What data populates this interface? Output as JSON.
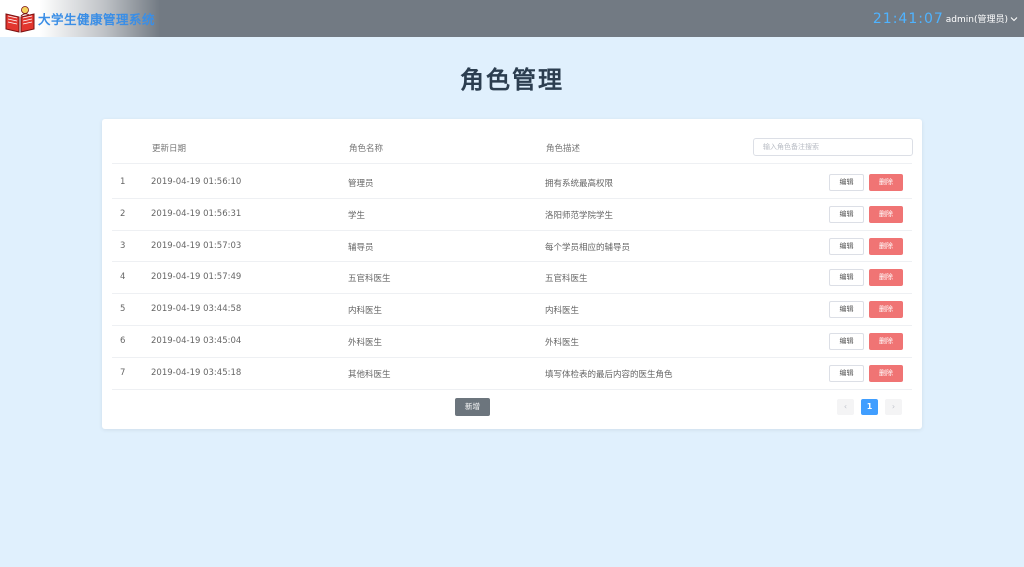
{
  "header": {
    "title": "大学生健康管理系统",
    "clock": "21:41:07",
    "user": "admin(管理员)",
    "colors": {
      "bar": "#727a83",
      "title": "#3a8ee6",
      "clock": "#4fb3ff"
    }
  },
  "page": {
    "title": "角色管理"
  },
  "table": {
    "columns": [
      "更新日期",
      "角色名称",
      "角色描述"
    ],
    "search_placeholder": "输入角色备注搜索",
    "edit_label": "编辑",
    "delete_label": "删除",
    "rows": [
      {
        "index": "1",
        "date": "2019-04-19 01:56:10",
        "name": "管理员",
        "desc": "拥有系统最高权限"
      },
      {
        "index": "2",
        "date": "2019-04-19 01:56:31",
        "name": "学生",
        "desc": "洛阳师范学院学生"
      },
      {
        "index": "3",
        "date": "2019-04-19 01:57:03",
        "name": "辅导员",
        "desc": "每个学员相应的辅导员"
      },
      {
        "index": "4",
        "date": "2019-04-19 01:57:49",
        "name": "五官科医生",
        "desc": "五官科医生"
      },
      {
        "index": "5",
        "date": "2019-04-19 03:44:58",
        "name": "内科医生",
        "desc": "内科医生"
      },
      {
        "index": "6",
        "date": "2019-04-19 03:45:04",
        "name": "外科医生",
        "desc": "外科医生"
      },
      {
        "index": "7",
        "date": "2019-04-19 03:45:18",
        "name": "其他科医生",
        "desc": "填写体检表的最后内容的医生角色"
      }
    ]
  },
  "footer": {
    "add_label": "新增",
    "pagination": {
      "prev": "‹",
      "current": "1",
      "next": "›"
    },
    "colors": {
      "delete": "#f07474",
      "add": "#6c757d",
      "page_active": "#409eff"
    }
  }
}
